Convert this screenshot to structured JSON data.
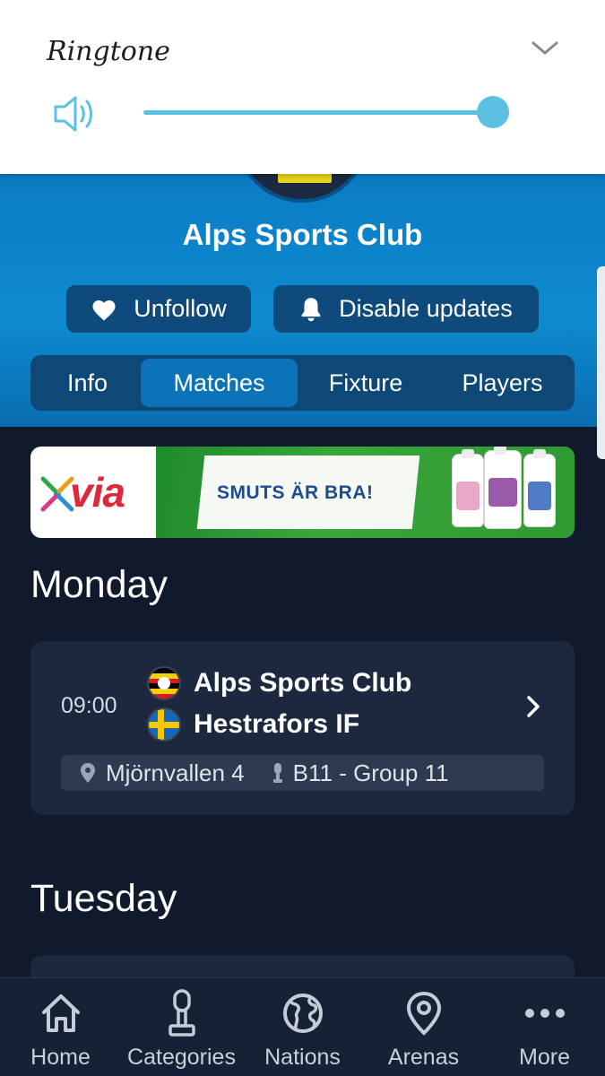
{
  "volume_panel": {
    "title": "Ringtone",
    "volume_level_percent": 100,
    "accent_color": "#5bc0e2",
    "icons": {
      "speaker": "speaker-icon",
      "collapse": "chevron-down-icon"
    }
  },
  "club": {
    "name": "Alps Sports Club",
    "unfollow_label": "Unfollow",
    "disable_updates_label": "Disable updates"
  },
  "tabs": [
    {
      "label": "Info",
      "active": false
    },
    {
      "label": "Matches",
      "active": true
    },
    {
      "label": "Fixture",
      "active": false
    },
    {
      "label": "Players",
      "active": false
    }
  ],
  "ad": {
    "brand": "via",
    "slogan": "SMUTS ÄR BRA!"
  },
  "days": [
    {
      "label": "Monday",
      "matches": [
        {
          "time": "09:00",
          "home_team": "Alps Sports Club",
          "away_team": "Hestrafors IF",
          "home_flag": "uganda-flag",
          "away_flag": "sweden-flag",
          "venue": "Mjörnvallen 4",
          "group": "B11 - Group 11"
        }
      ]
    },
    {
      "label": "Tuesday",
      "matches": []
    }
  ],
  "bottom_nav": [
    {
      "label": "Home",
      "icon": "home-icon"
    },
    {
      "label": "Categories",
      "icon": "trophy-icon"
    },
    {
      "label": "Nations",
      "icon": "globe-icon"
    },
    {
      "label": "Arenas",
      "icon": "location-pin-icon"
    },
    {
      "label": "More",
      "icon": "more-dots-icon"
    }
  ],
  "colors": {
    "background": "#101a2c",
    "header_blue": "#0b7ec5",
    "card": "#1c283d",
    "active_tab": "#0c73b8"
  }
}
